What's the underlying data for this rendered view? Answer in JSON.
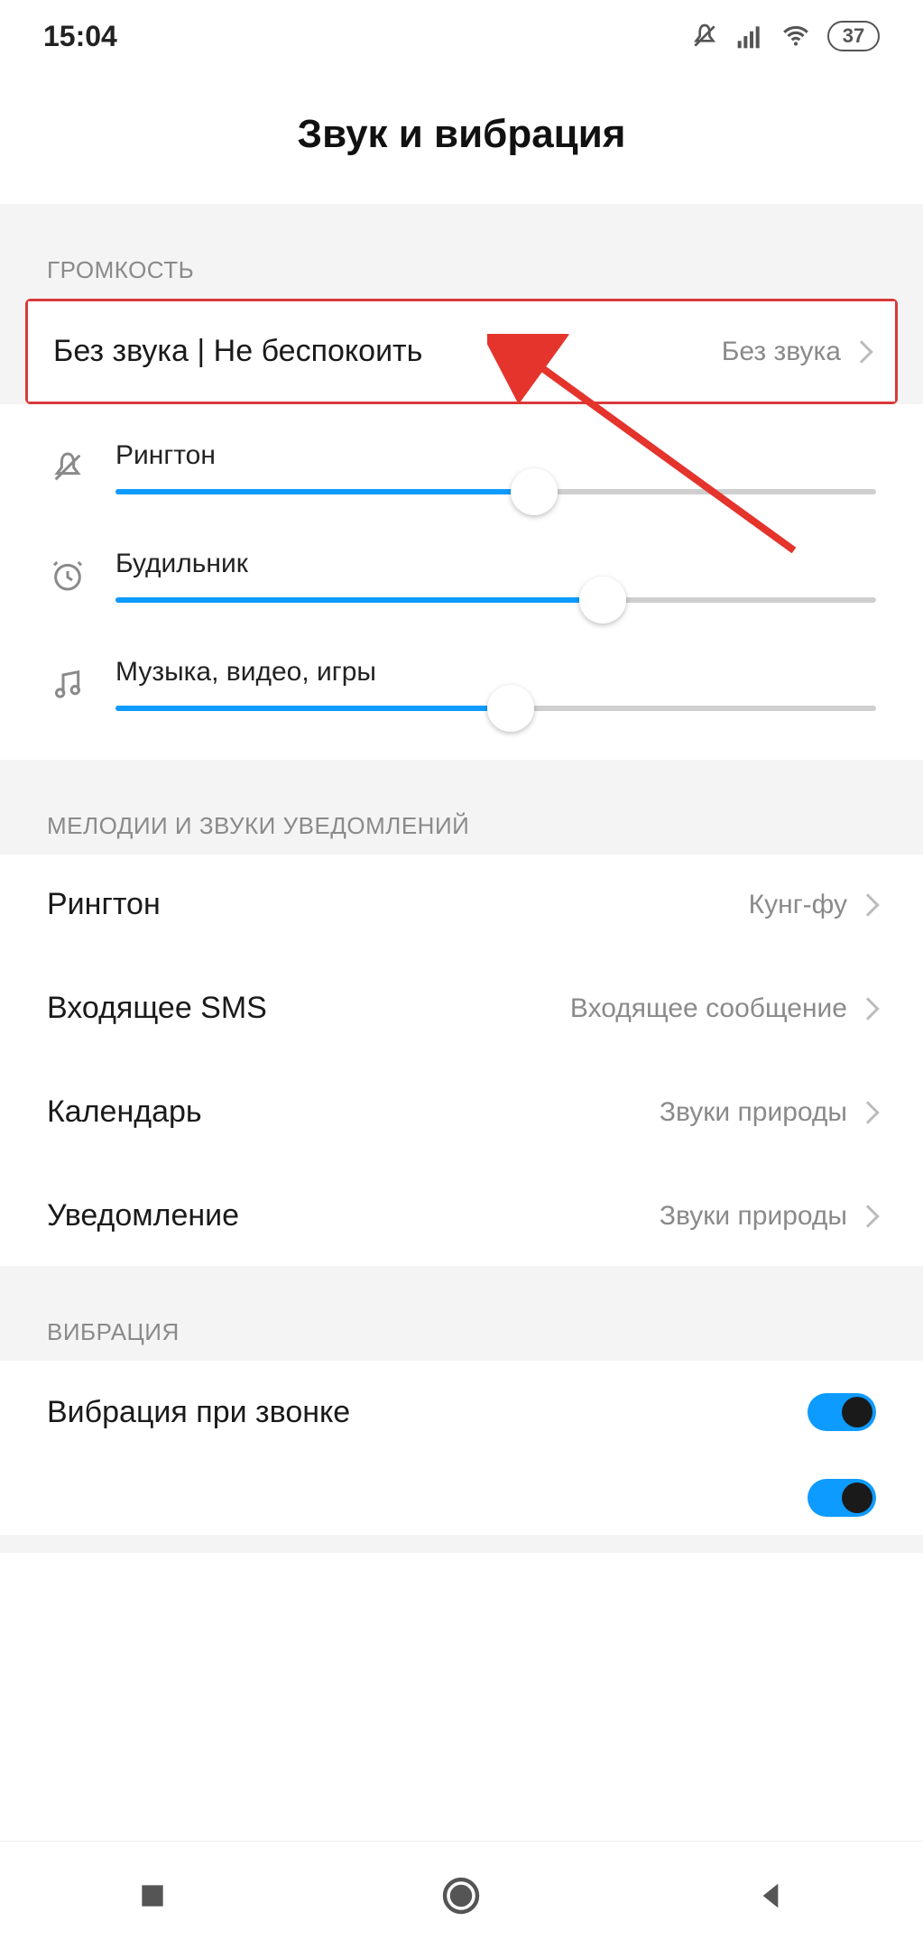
{
  "status": {
    "time": "15:04",
    "battery": "37"
  },
  "header": {
    "title": "Звук и вибрация"
  },
  "sections": {
    "volume": {
      "label": "ГРОМКОСТЬ",
      "silent": {
        "label": "Без звука | Не беспокоить",
        "value": "Без звука"
      },
      "sliders": {
        "ringtone": {
          "label": "Рингтон",
          "percent": 55
        },
        "alarm": {
          "label": "Будильник",
          "percent": 64
        },
        "media": {
          "label": "Музыка, видео, игры",
          "percent": 52
        }
      }
    },
    "sounds": {
      "label": "МЕЛОДИИ И ЗВУКИ УВЕДОМЛЕНИЙ",
      "items": {
        "ringtone": {
          "label": "Рингтон",
          "value": "Кунг-фу"
        },
        "sms": {
          "label": "Входящее SMS",
          "value": "Входящее сообщение"
        },
        "calendar": {
          "label": "Календарь",
          "value": "Звуки природы"
        },
        "notification": {
          "label": "Уведомление",
          "value": "Звуки природы"
        }
      }
    },
    "vibration": {
      "label": "ВИБРАЦИЯ",
      "items": {
        "vibrate_on_call": {
          "label": "Вибрация при звонке",
          "on": true
        }
      }
    }
  }
}
